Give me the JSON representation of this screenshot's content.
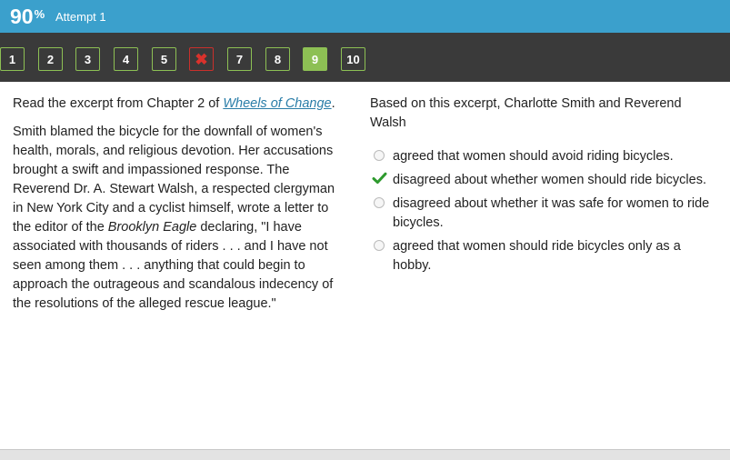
{
  "header": {
    "score_value": "90",
    "score_unit": "%",
    "attempt_label": "Attempt 1"
  },
  "question_nav": [
    {
      "label": "1",
      "state": "correct"
    },
    {
      "label": "2",
      "state": "correct"
    },
    {
      "label": "3",
      "state": "correct"
    },
    {
      "label": "4",
      "state": "correct"
    },
    {
      "label": "5",
      "state": "correct"
    },
    {
      "label": "",
      "state": "incorrect",
      "icon": "x-icon"
    },
    {
      "label": "7",
      "state": "correct"
    },
    {
      "label": "8",
      "state": "correct"
    },
    {
      "label": "9",
      "state": "current"
    },
    {
      "label": "10",
      "state": "correct"
    }
  ],
  "passage": {
    "intro_prefix": "Read the excerpt from Chapter 2 of ",
    "book_title": "Wheels of Change",
    "intro_suffix": ".",
    "body_part1": "Smith blamed the bicycle for the downfall of women's health, morals, and religious devotion. Her accusations brought a swift and impassioned response. The Reverend Dr. A. Stewart Walsh, a respected clergyman in New York City and a cyclist himself, wrote a letter to the editor of the ",
    "newspaper": "Brooklyn Eagle",
    "body_part2": " declaring, \"I have associated with thousands of riders . . . and I have not seen among them . . . anything that could begin to approach the outrageous and scandalous indecency of the resolutions of the alleged rescue league.\""
  },
  "question": {
    "prompt": "Based on this excerpt, Charlotte Smith and Reverend Walsh",
    "options": [
      {
        "text": "agreed that women should avoid riding bicycles.",
        "selected": false
      },
      {
        "text": "disagreed about whether women should ride bicycles.",
        "selected": true
      },
      {
        "text": "disagreed about whether it was safe for women to ride bicycles.",
        "selected": false
      },
      {
        "text": "agreed that women should ride bicycles only as a hobby.",
        "selected": false
      }
    ]
  },
  "colors": {
    "header_bg": "#3ba0cc",
    "nav_bg": "#3a3a3a",
    "correct_green": "#8dc054",
    "wrong_red": "#d9322c",
    "check_green": "#2e9a2e",
    "link_blue": "#2a7da8"
  }
}
